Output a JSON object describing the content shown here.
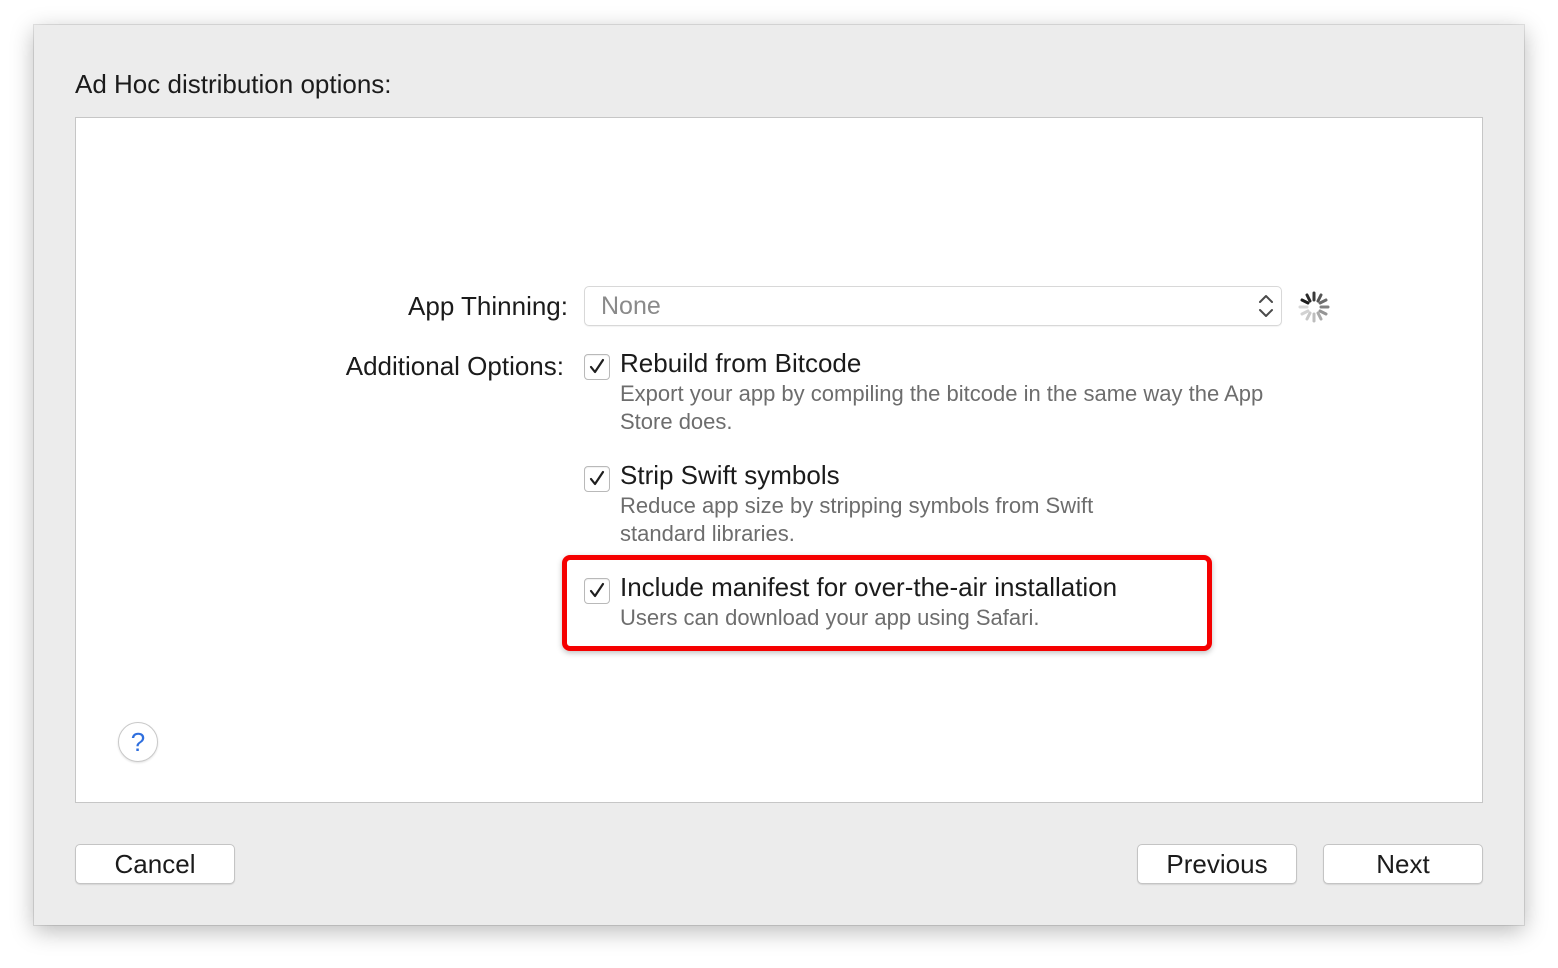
{
  "dialog": {
    "title": "Ad Hoc distribution options:"
  },
  "app_thinning": {
    "label": "App Thinning:",
    "selected": "None",
    "loading_icon": "spinner-icon"
  },
  "additional_options": {
    "label": "Additional Options:",
    "items": [
      {
        "title": "Rebuild from Bitcode",
        "description": "Export your app by compiling the bitcode in the same way the App Store does.",
        "checked": true
      },
      {
        "title": "Strip Swift symbols",
        "description": "Reduce app size by stripping symbols from Swift standard libraries.",
        "checked": true
      },
      {
        "title": "Include manifest for over-the-air installation",
        "description": "Users can download your app using Safari.",
        "checked": true
      }
    ]
  },
  "help": {
    "label": "?"
  },
  "buttons": {
    "cancel": "Cancel",
    "previous": "Previous",
    "next": "Next"
  },
  "colors": {
    "highlight": "#f50000",
    "help_glyph": "#2f6fde"
  }
}
